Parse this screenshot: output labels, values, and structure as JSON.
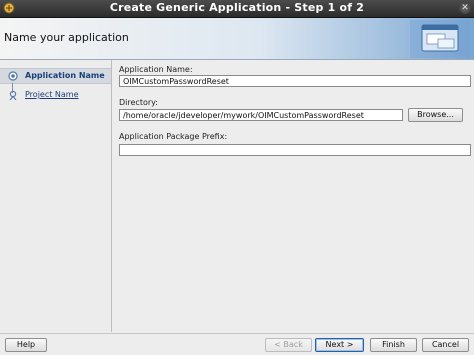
{
  "window": {
    "title": "Create Generic Application - Step 1 of 2"
  },
  "banner": {
    "heading": "Name your application"
  },
  "steps": [
    {
      "label": "Application Name",
      "active": true
    },
    {
      "label": "Project Name",
      "active": false
    }
  ],
  "form": {
    "app_name_label": "Application Name:",
    "app_name_value": "OIMCustomPasswordReset",
    "directory_label": "Directory:",
    "directory_value": "/home/oracle/jdeveloper/mywork/OIMCustomPasswordReset",
    "browse_label": "Browse...",
    "package_prefix_label": "Application Package Prefix:",
    "package_prefix_value": ""
  },
  "footer": {
    "help_label": "Help",
    "back_label": "< Back",
    "next_label": "Next >",
    "finish_label": "Finish",
    "cancel_label": "Cancel"
  }
}
